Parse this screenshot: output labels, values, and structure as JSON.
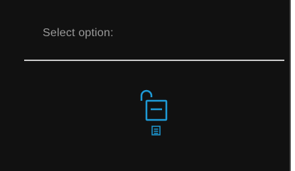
{
  "dialog": {
    "title": "Select option:",
    "options": [
      {
        "icon": "unlock-icon",
        "sub_icon": "document-icon"
      }
    ]
  },
  "colors": {
    "background": "#111111",
    "title_text": "#9a9a9a",
    "divider": "#c9c9c9",
    "accent": "#1e9ad6"
  }
}
